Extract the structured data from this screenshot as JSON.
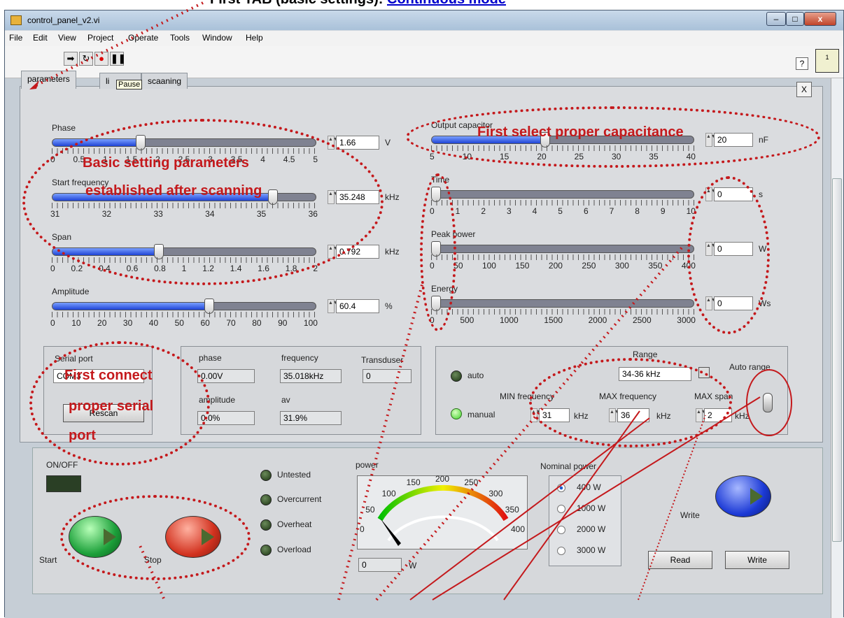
{
  "header_caption": {
    "prefix": "First TAB (basic settings):",
    "link": "Continuous mode"
  },
  "window": {
    "title": "control_panel_v2.vi",
    "btn_minimize": "–",
    "btn_maximize": "□",
    "btn_close": "x"
  },
  "menu": [
    "File",
    "Edit",
    "View",
    "Project",
    "Operate",
    "Tools",
    "Window",
    "Help"
  ],
  "toolbar": {
    "help": "?",
    "vi_icon_label": "1"
  },
  "tabs": [
    "parameters",
    "li",
    "scaaning"
  ],
  "tooltip": "Pause",
  "close_tab_button": "X",
  "left_sliders": [
    {
      "label": "Phase",
      "value": "1.66",
      "unit": "V",
      "fraction": 0.33,
      "ticks": [
        "0",
        "0.5",
        "1",
        "1.5",
        "2",
        "2.5",
        "3",
        "3.5",
        "4",
        "4.5",
        "5"
      ]
    },
    {
      "label": "Start frequency",
      "value": "35.248",
      "unit": "kHz",
      "fraction": 0.85,
      "ticks": [
        "31",
        "32",
        "33",
        "34",
        "35",
        "36"
      ]
    },
    {
      "label": "Span",
      "value": "0.792",
      "unit": "kHz",
      "fraction": 0.4,
      "ticks": [
        "0",
        "0.2",
        "0.4",
        "0.6",
        "0.8",
        "1",
        "1.2",
        "1.4",
        "1.6",
        "1.8",
        "2"
      ]
    },
    {
      "label": "Amplitude",
      "value": "60.4",
      "unit": "%",
      "fraction": 0.6,
      "ticks": [
        "0",
        "10",
        "20",
        "30",
        "40",
        "50",
        "60",
        "70",
        "80",
        "90",
        "100"
      ]
    }
  ],
  "right_sliders": [
    {
      "label": "Output capacitor",
      "value": "20",
      "unit": "nF",
      "fraction": 0.43,
      "ticks": [
        "5",
        "10",
        "15",
        "20",
        "25",
        "30",
        "35",
        "40"
      ]
    },
    {
      "label": "Time",
      "value": "0",
      "unit": "s",
      "fraction": 0.0,
      "ticks": [
        "0",
        "1",
        "2",
        "3",
        "4",
        "5",
        "6",
        "7",
        "8",
        "9",
        "10"
      ]
    },
    {
      "label": "Peak power",
      "value": "0",
      "unit": "W",
      "fraction": 0.0,
      "ticks": [
        "0",
        "50",
        "100",
        "150",
        "200",
        "250",
        "300",
        "350",
        "400"
      ]
    },
    {
      "label": "Energy",
      "value": "0",
      "unit": "Ws",
      "fraction": 0.0,
      "ticks": [
        "0",
        "500",
        "1000",
        "1500",
        "2000",
        "2500",
        "3000"
      ]
    }
  ],
  "serial": {
    "label": "Serial port",
    "value": "COM3",
    "rescan": "Rescan"
  },
  "readout": {
    "phase_label": "phase",
    "phase": "0.00V",
    "frequency_label": "frequency",
    "frequency": "35.018kHz",
    "transducer_label": "Transduser",
    "transducer": "0",
    "amplitude_label": "amplitude",
    "amplitude": "0.0%",
    "av_label": "av",
    "av": "31.9%"
  },
  "mode": {
    "auto": "auto",
    "manual": "manual",
    "range_label": "Range",
    "range_value": "34-36 kHz",
    "auto_range": "Auto range",
    "min_freq_label": "MIN frequency",
    "min_freq": "31",
    "min_unit": "kHz",
    "max_freq_label": "MAX frequency",
    "max_freq": "36",
    "max_unit": "kHz",
    "max_span_label": "MAX span",
    "max_span": "2",
    "span_unit": "kHz"
  },
  "bottom": {
    "onoff": "ON/OFF",
    "start": "Start",
    "stop": "Stop",
    "status": [
      "Untested",
      "Overcurrent",
      "Overheat",
      "Overload"
    ],
    "power_label": "power",
    "power_value": "0",
    "power_unit": "W",
    "gauge_ticks": [
      "0",
      "50",
      "100",
      "150",
      "200",
      "250",
      "300",
      "350",
      "400"
    ],
    "nominal_label": "Nominal power",
    "nominal_options": [
      "400 W",
      "1000 W",
      "2000 W",
      "3000 W"
    ],
    "write_label": "Write",
    "read_btn": "Read",
    "write_btn": "Write"
  },
  "annotations": {
    "basic_1": "Basic setting parameters",
    "basic_2": "established after scanning",
    "capacitance": "First select proper capacitance",
    "serial_1": "First connect",
    "serial_2": "proper serial",
    "serial_3": "port"
  },
  "colors": {
    "annotation": "#c4191c",
    "slider_fill": "#1f44d6",
    "start_btn": "#2fbf3a",
    "stop_btn": "#d83a2a",
    "write_btn": "#1f3fd8"
  }
}
